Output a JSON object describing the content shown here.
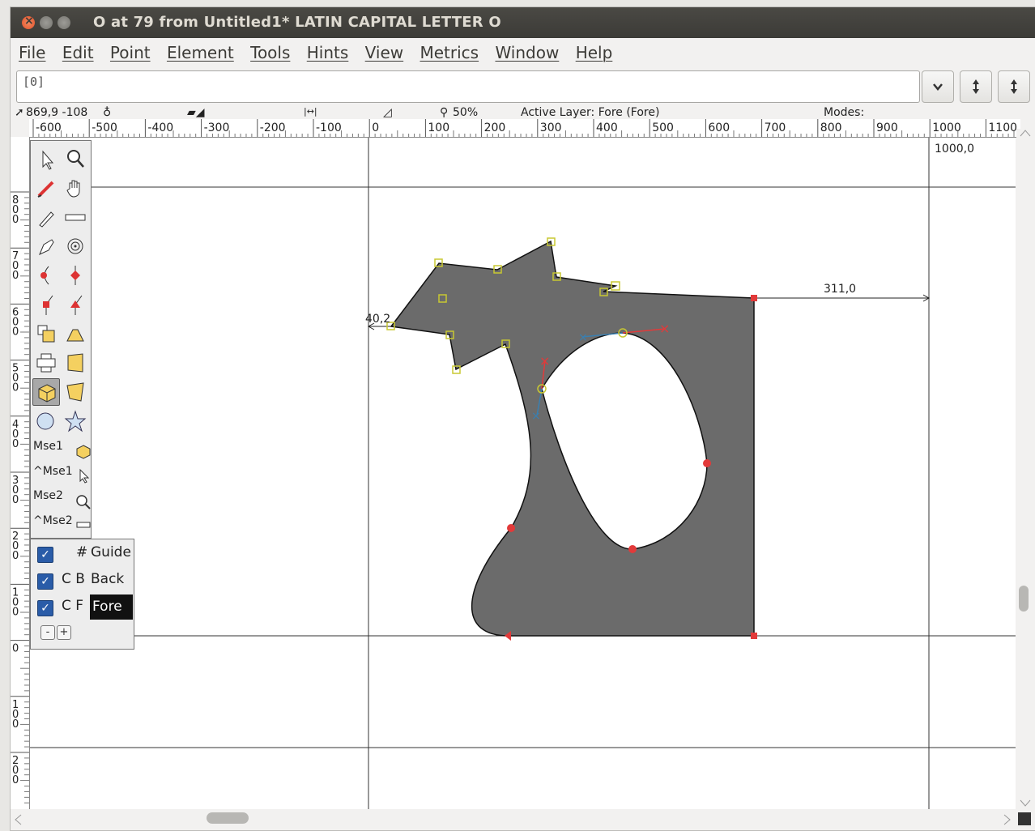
{
  "window": {
    "title": "O at 79 from Untitled1* LATIN CAPITAL LETTER O"
  },
  "menu": [
    "File",
    "Edit",
    "Point",
    "Element",
    "Tools",
    "Hints",
    "View",
    "Metrics",
    "Window",
    "Help"
  ],
  "combo": {
    "value": "[0]"
  },
  "info": {
    "coords": "869,9 -108",
    "zoom": "50%",
    "active_layer": "Active Layer: Fore (Fore)",
    "modes": "Modes:"
  },
  "hruler_labels": [
    "-600",
    "-500",
    "-400",
    "-300",
    "-200",
    "-100",
    "0",
    "100",
    "200",
    "300",
    "400",
    "500",
    "600",
    "700",
    "800",
    "900",
    "1000",
    "1100"
  ],
  "vruler_labels": [
    "800",
    "700",
    "600",
    "500",
    "400",
    "300",
    "200",
    "100",
    "0",
    "100",
    "200"
  ],
  "canvas": {
    "advance_label": "1000,0",
    "right_measure": "311,0",
    "left_measure": "40,2"
  },
  "tools": {
    "mse1": "Mse1",
    "cmse1": "^Mse1",
    "mse2": "Mse2",
    "cmse2": "^Mse2"
  },
  "layers": [
    {
      "prefix": "#",
      "name": "Guide",
      "checked": true
    },
    {
      "prefix": "C B",
      "name": "Back",
      "checked": true
    },
    {
      "prefix": "C F",
      "name": "Fore",
      "checked": true
    }
  ],
  "layer_buttons": {
    "remove": "-",
    "add": "+"
  },
  "colors": {
    "glyph_fill": "#6b6b6b",
    "selected_point": "#c8c832",
    "curve_point": "#e23a3a",
    "control_blue": "#3a7fb0"
  }
}
